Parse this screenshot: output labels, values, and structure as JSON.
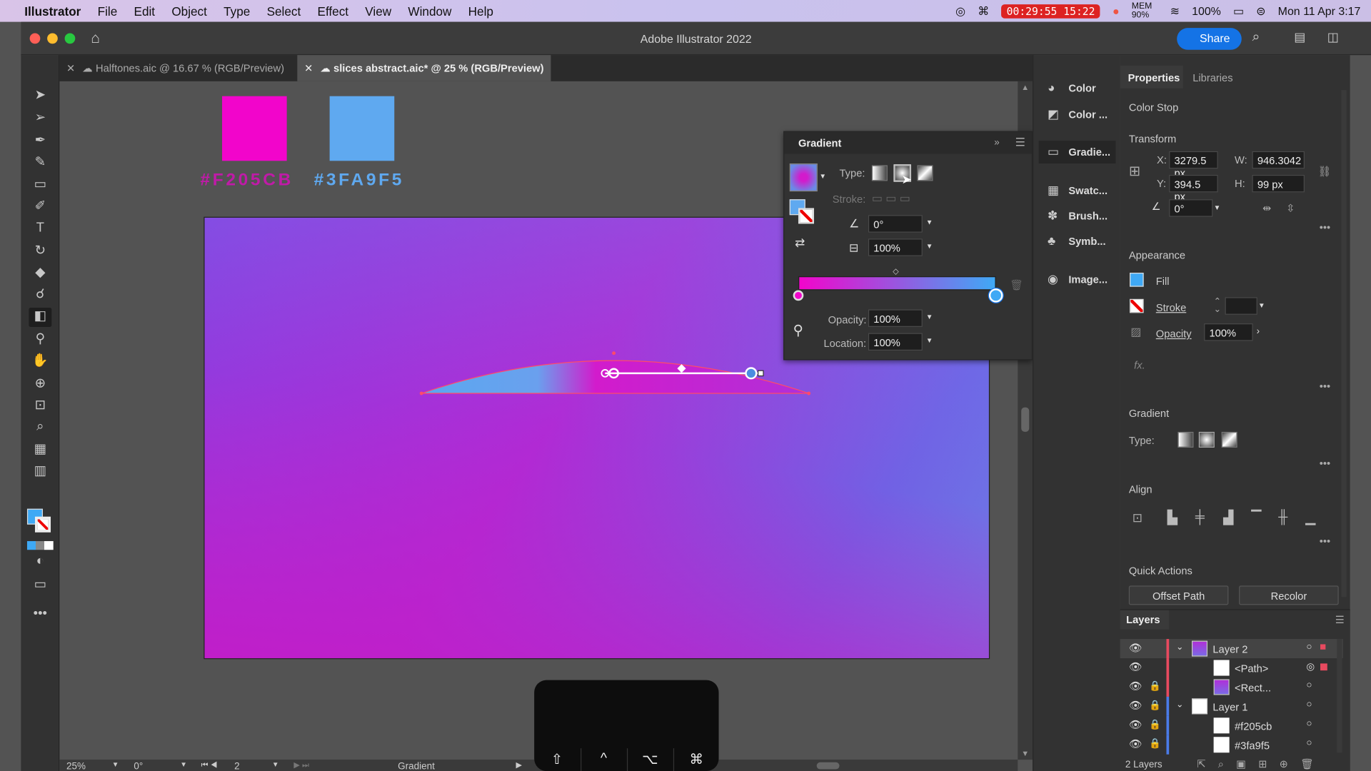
{
  "menubar": {
    "app": "Illustrator",
    "items": [
      "File",
      "Edit",
      "Object",
      "Type",
      "Select",
      "Effect",
      "View",
      "Window",
      "Help"
    ],
    "timer": "00:29:55",
    "time_short": "15:22",
    "mem": "MEM 90%",
    "battery": "100%",
    "clock": "Mon 11 Apr  3:17"
  },
  "window": {
    "title": "Adobe Illustrator 2022",
    "share": "Share"
  },
  "tabs": [
    {
      "label": "Halftones.aic @ 16.67 % (RGB/Preview)"
    },
    {
      "label": "slices abstract.aic* @ 25 % (RGB/Preview)"
    }
  ],
  "swatches": [
    {
      "hex_label": "#F205CB",
      "color": "#f205cb"
    },
    {
      "hex_label": "#3FA9F5",
      "color": "#3fa9f5"
    }
  ],
  "gradient_panel": {
    "title": "Gradient",
    "type_label": "Type:",
    "stroke_label": "Stroke:",
    "angle": "0°",
    "aspect": "100%",
    "opacity_label": "Opacity:",
    "opacity": "100%",
    "location_label": "Location:",
    "location": "100%"
  },
  "dock": {
    "items": [
      "Color",
      "Color ...",
      "Gradie...",
      "Swatc...",
      "Brush...",
      "Symb...",
      "Image..."
    ]
  },
  "properties": {
    "tabs": [
      "Properties",
      "Libraries"
    ],
    "context": "Color Stop",
    "transform": "Transform",
    "x_label": "X:",
    "x": "3279.5 px",
    "y_label": "Y:",
    "y": "394.5 px",
    "w_label": "W:",
    "w": "946.3042",
    "h_label": "H:",
    "h": "99 px",
    "rotate": "0°",
    "appearance": "Appearance",
    "fill": "Fill",
    "stroke": "Stroke",
    "opacity": "Opacity",
    "opacity_value": "100%",
    "fx": "fx.",
    "gradient": "Gradient",
    "type": "Type:",
    "align": "Align",
    "quick_actions": "Quick Actions",
    "offset_path": "Offset Path",
    "recolor": "Recolor"
  },
  "layers": {
    "title": "Layers",
    "rows": [
      {
        "name": "Layer 2"
      },
      {
        "name": "<Path>"
      },
      {
        "name": "<Rect..."
      },
      {
        "name": "Layer 1"
      },
      {
        "name": "#f205cb"
      },
      {
        "name": "#3fa9f5"
      }
    ],
    "count": "2 Layers"
  },
  "statusbar": {
    "zoom": "25%",
    "rotation": "0°",
    "artboard": "2",
    "tool": "Gradient"
  },
  "keypad": {
    "keys": [
      "⇧",
      "^",
      "⌥",
      "⌘"
    ]
  },
  "colors": {
    "accent": "#1473e6",
    "magenta": "#f205cb",
    "blue": "#3fa9f5"
  }
}
